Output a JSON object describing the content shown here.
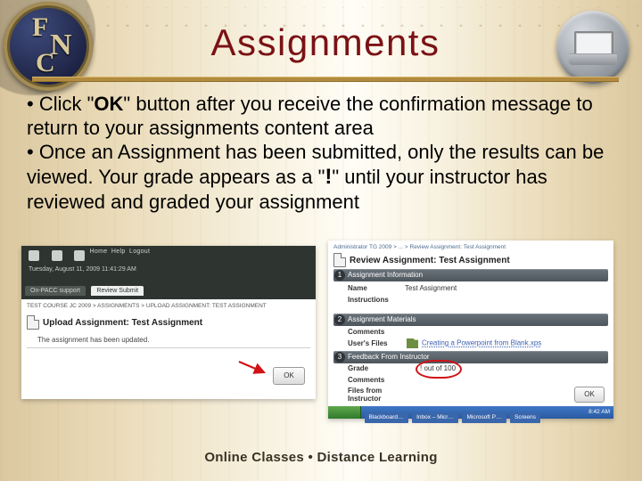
{
  "title": "Assignments",
  "bullets": {
    "b1_prefix": "•  Click \"",
    "b1_ok": "OK",
    "b1_suffix": "\" button after you receive  the confirmation message to return to your assignments content area",
    "b2_prefix": "• Once an Assignment has been submitted, only the results can be viewed. Your grade appears as a \"",
    "b2_excl": "!",
    "b2_suffix": "\" until your instructor has reviewed and graded your assignment"
  },
  "left_shot": {
    "nav_home": "Home",
    "nav_help": "Help",
    "nav_logout": "Logout",
    "tab1": "On-PACC support",
    "tab2": "Review Submit",
    "breadcrumb": "TEST COURSE JC 2009 > ASSIGNMENTS > UPLOAD ASSIGNMENT: TEST ASSIGNMENT",
    "section_title": "Upload Assignment: Test Assignment",
    "status_msg": "The assignment has been updated.",
    "date_line": "Tuesday, August 11, 2009 11:41:29 AM",
    "ok": "OK"
  },
  "right_shot": {
    "breadcrumb": "Administrator TG 2009 > ... > Review Assignment: Test Assignment",
    "section_title": "Review Assignment: Test Assignment",
    "bar1": "Assignment Information",
    "name_label": "Name",
    "name_value": "Test Assignment",
    "instructions_label": "Instructions",
    "bar2": "Assignment Materials",
    "comments_label": "Comments",
    "userfiles_label": "User's Files",
    "file_link": "Creating a Powerpoint from Blank.xps",
    "bar3": "Feedback From Instructor",
    "grade_label": "Grade",
    "grade_value": "! out of 100",
    "fb_comments_label": "Comments",
    "fb_files_label": "Files from Instructor",
    "ok": "OK",
    "taskbar": {
      "item1": "Blackboard…",
      "item2": "Inbox – Micr…",
      "item3": "Microsoft P…",
      "item4": "Screens",
      "clock": "8:42 AM"
    }
  },
  "footer": "Online Classes  •  Distance Learning",
  "icons": {
    "logo_e": "F",
    "logo_n": "N",
    "logo_c": "C"
  }
}
